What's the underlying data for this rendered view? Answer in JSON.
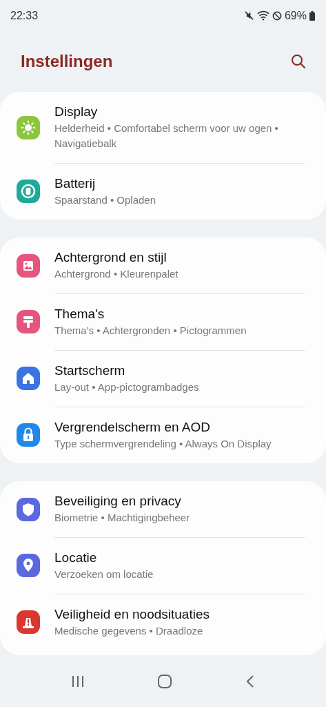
{
  "status_bar": {
    "time": "22:33",
    "battery": "69%"
  },
  "header": {
    "title": "Instellingen"
  },
  "groups": [
    {
      "items": [
        {
          "title": "Display",
          "subtitle": "Helderheid • Comfortabel scherm voor uw ogen • Navigatiebalk",
          "color": "#8cc63f"
        },
        {
          "title": "Batterij",
          "subtitle": "Spaarstand • Opladen",
          "color": "#1fa99b"
        }
      ]
    },
    {
      "items": [
        {
          "title": "Achtergrond en stijl",
          "subtitle": "Achtergrond • Kleurenpalet",
          "color": "#e5557e"
        },
        {
          "title": "Thema's",
          "subtitle": "Thema's • Achtergronden • Pictogrammen",
          "color": "#e5557e"
        },
        {
          "title": "Startscherm",
          "subtitle": "Lay-out • App-pictogrambadges",
          "color": "#3b73e0"
        },
        {
          "title": "Vergrendelscherm en AOD",
          "subtitle": "Type schermvergrendeling • Always On Display",
          "color": "#1f88ea"
        }
      ]
    },
    {
      "items": [
        {
          "title": "Beveiliging en privacy",
          "subtitle": "Biometrie • Machtigingbeheer",
          "color": "#5b68e0"
        },
        {
          "title": "Locatie",
          "subtitle": "Verzoeken om locatie",
          "color": "#5b68e0"
        },
        {
          "title": "Veiligheid en noodsituaties",
          "subtitle": "Medische gegevens • Draadloze",
          "color": "#d9372f"
        }
      ]
    }
  ]
}
